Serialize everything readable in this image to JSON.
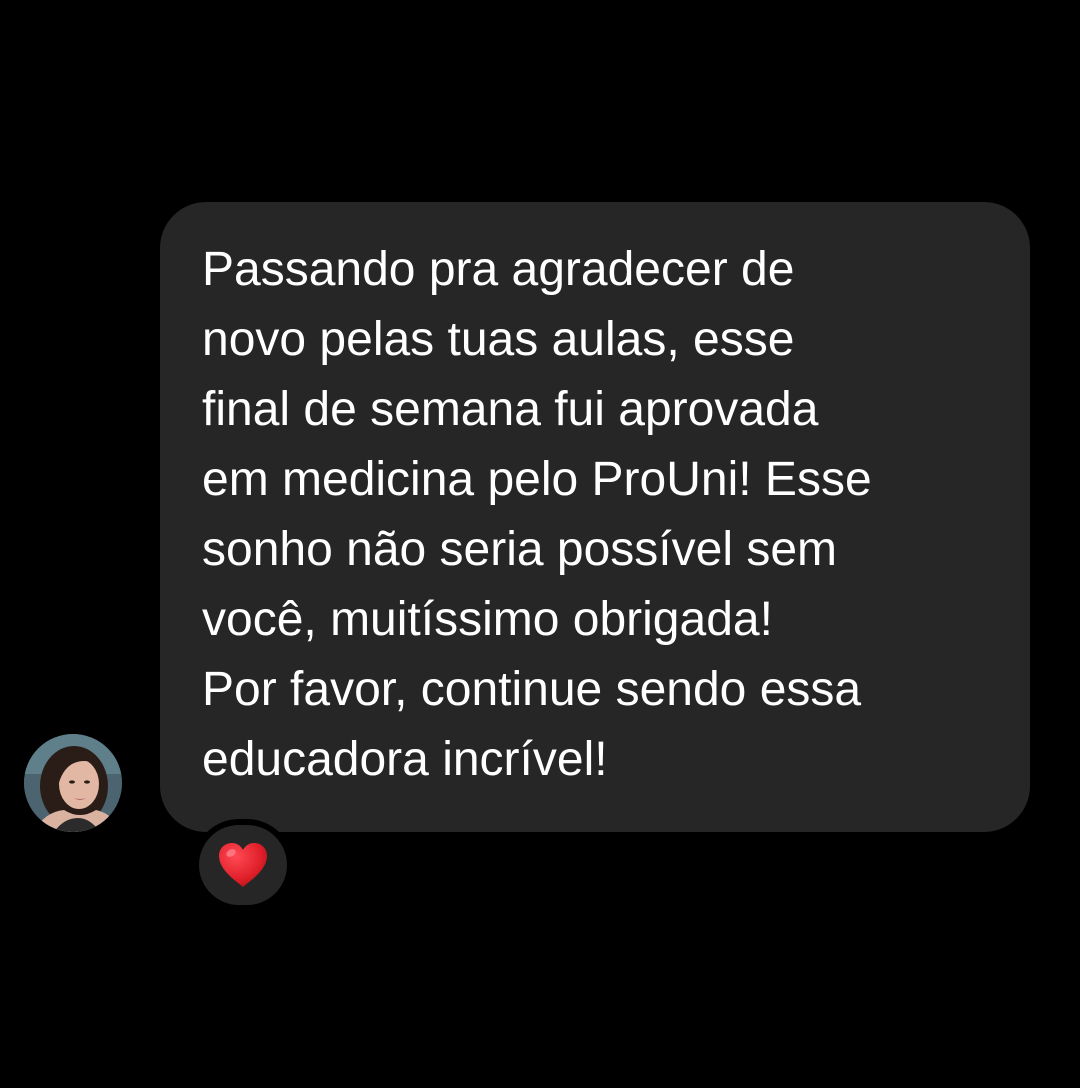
{
  "message": {
    "lines": [
      "Passando pra agradecer de",
      "novo pelas tuas aulas, esse",
      "final de semana fui aprovada",
      "em medicina pelo ProUni! Esse",
      "sonho não seria possível sem",
      "você, muitíssimo obrigada!",
      "Por favor, continue sendo essa",
      "educadora incrível!"
    ]
  },
  "sender": {
    "avatar_icon": "profile-photo"
  },
  "reaction": {
    "icon": "red-heart-icon",
    "color": "#e0202a"
  },
  "colors": {
    "background": "#000000",
    "bubble": "#262626",
    "text": "#ffffff"
  }
}
